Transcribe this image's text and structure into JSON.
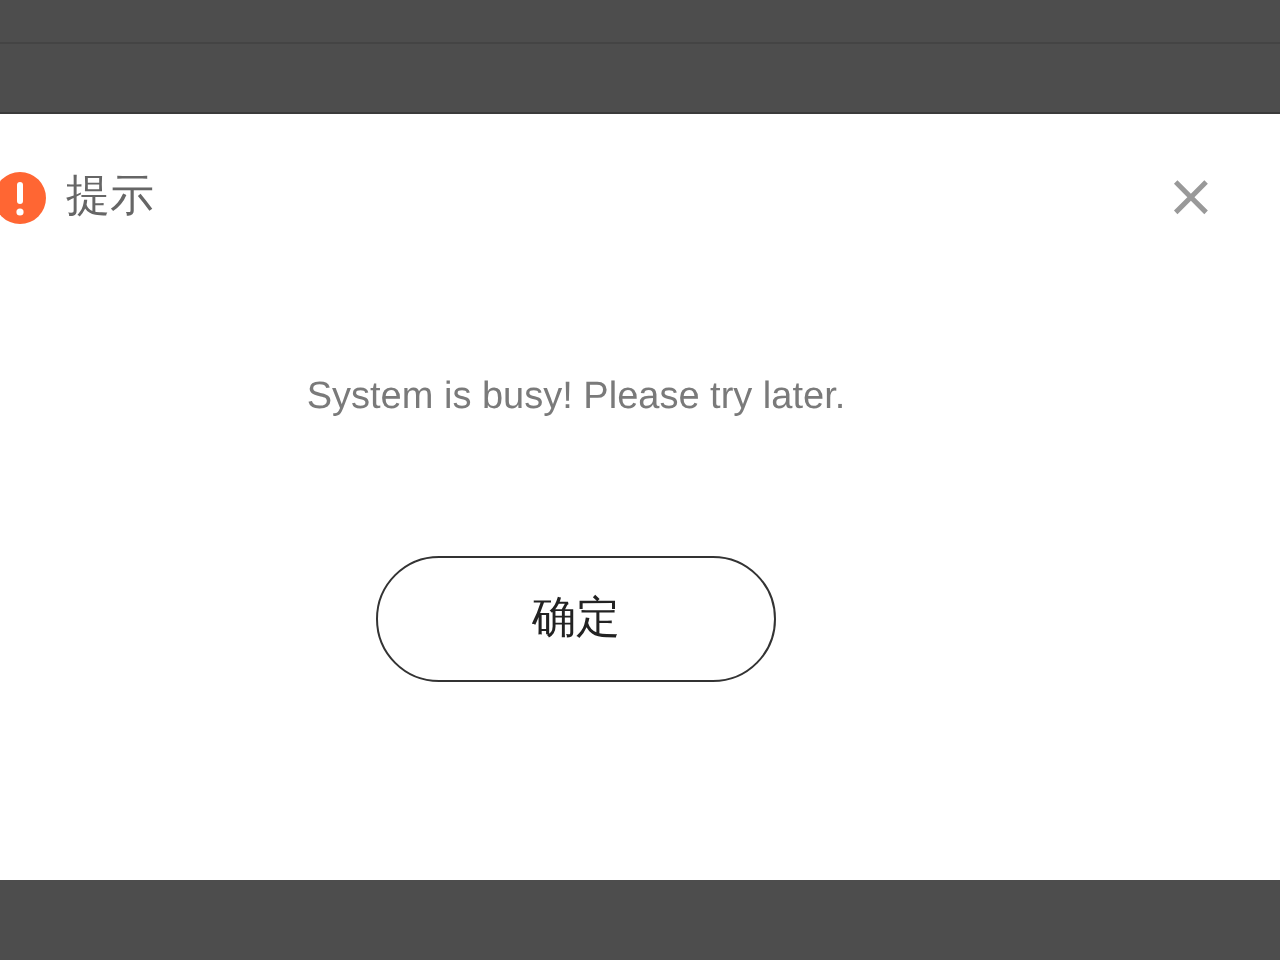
{
  "dialog": {
    "title": "提示",
    "close_label": "×",
    "message": "System is busy! Please try later.",
    "buttons": [
      "确定"
    ]
  }
}
